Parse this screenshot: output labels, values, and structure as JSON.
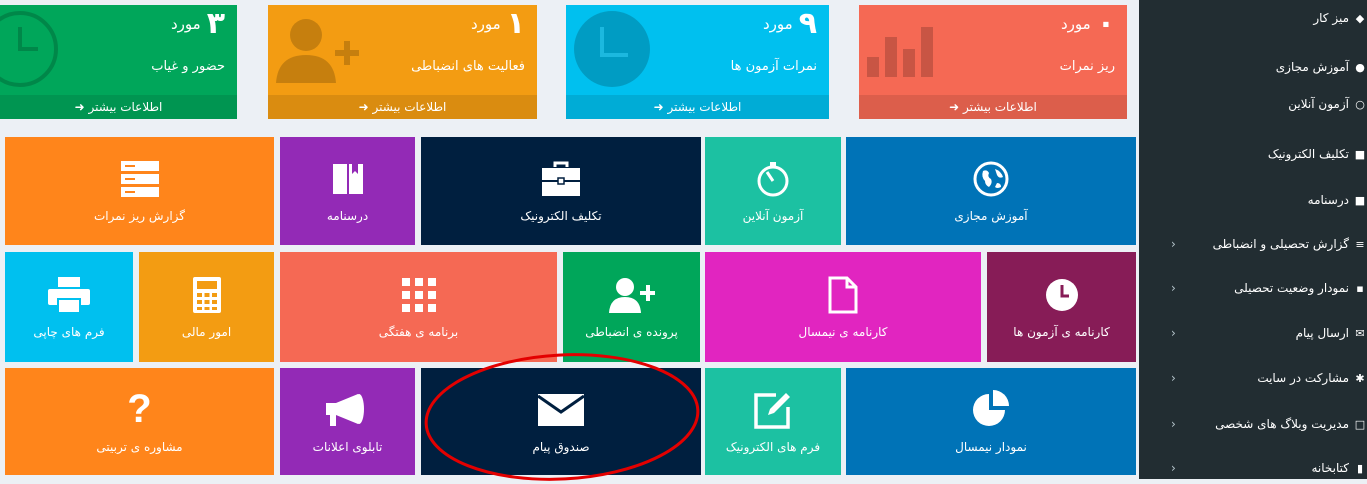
{
  "stats": [
    {
      "number": "۰",
      "unit": "مورد",
      "label": "ریز نمرات",
      "more": "اطلاعات بیشتر",
      "color": "#f56954",
      "footer_color": "#dc5e4b"
    },
    {
      "number": "۹",
      "unit": "مورد",
      "label": "نمرات آزمون ها",
      "more": "اطلاعات بیشتر",
      "color": "#00c0ef",
      "footer_color": "#00acd6"
    },
    {
      "number": "۱",
      "unit": "مورد",
      "label": "فعالیت های انضباطی",
      "more": "اطلاعات بیشتر",
      "color": "#f39c12",
      "footer_color": "#da8c10"
    },
    {
      "number": "۳",
      "unit": "مورد",
      "label": "حضور و غیاب",
      "more": "اطلاعات بیشتر",
      "color": "#00a65a",
      "footer_color": "#009551"
    }
  ],
  "tiles": {
    "virtual_learning": {
      "label": "آموزش مجازی",
      "icon": "globe-icon",
      "color": "#0073b7"
    },
    "online_exam": {
      "label": "آزمون آنلاین",
      "icon": "stopwatch-icon",
      "color": "#1cc1a2"
    },
    "homework": {
      "label": "تکلیف الکترونیک",
      "icon": "briefcase-icon",
      "color": "#001f3f"
    },
    "lesson_plan": {
      "label": "درسنامه",
      "icon": "book-icon",
      "color": "#932ab6"
    },
    "grades_report": {
      "label": "گزارش ریز نمرات",
      "icon": "list-icon",
      "color": "#ff851b"
    },
    "exam_report_card": {
      "label": "کارنامه ی آزمون ها",
      "icon": "clock-icon",
      "color": "#871c57"
    },
    "semester_report_card": {
      "label": "کارنامه ی نیمسال",
      "icon": "file-icon",
      "color": "#e125c0"
    },
    "discipline_file": {
      "label": "پرونده ی انضباطی",
      "icon": "user-plus-icon",
      "color": "#00a65a"
    },
    "weekly_schedule": {
      "label": "برنامه ی هفتگی",
      "icon": "grid-icon",
      "color": "#f56954"
    },
    "finance": {
      "label": "امور مالی",
      "icon": "calculator-icon",
      "color": "#f39c12"
    },
    "print_forms": {
      "label": "فرم های چاپی",
      "icon": "printer-icon",
      "color": "#00c0ef"
    },
    "semester_chart": {
      "label": "نمودار نیمسال",
      "icon": "pie-chart-icon",
      "color": "#0073b7"
    },
    "e_forms": {
      "label": "فرم های الکترونیک",
      "icon": "edit-icon",
      "color": "#1cc1a2"
    },
    "inbox": {
      "label": "صندوق پیام",
      "icon": "envelope-icon",
      "color": "#001f3f"
    },
    "notice_board": {
      "label": "تابلوی اعلانات",
      "icon": "megaphone-icon",
      "color": "#932ab6"
    },
    "counseling": {
      "label": "مشاوره ی تربیتی",
      "icon": "question-icon",
      "color": "#ff851b"
    }
  },
  "sidebar": {
    "items": [
      {
        "label": "میز کار",
        "icon": "dashboard-icon",
        "has_children": false
      },
      {
        "label": "آموزش مجازی",
        "icon": "globe-icon",
        "has_children": false
      },
      {
        "label": "آزمون آنلاین",
        "icon": "timer-icon",
        "has_children": false
      },
      {
        "label": "تکلیف الکترونیک",
        "icon": "briefcase-icon",
        "has_children": false
      },
      {
        "label": "درسنامه",
        "icon": "book-icon",
        "has_children": false
      },
      {
        "label": "گزارش تحصیلی و انضباطی",
        "icon": "list-icon",
        "has_children": true
      },
      {
        "label": "نمودار وضعیت تحصیلی",
        "icon": "chart-icon",
        "has_children": true
      },
      {
        "label": "ارسال پیام",
        "icon": "envelope-icon",
        "has_children": true
      },
      {
        "label": "مشارکت در سایت",
        "icon": "cog-icon",
        "has_children": true
      },
      {
        "label": "مدیریت وبلاگ های شخصی",
        "icon": "blog-icon",
        "has_children": true
      },
      {
        "label": "کتابخانه",
        "icon": "library-icon",
        "has_children": true
      }
    ]
  },
  "annotation": {
    "shape": "ellipse",
    "color": "#e30000",
    "target": "inbox"
  }
}
